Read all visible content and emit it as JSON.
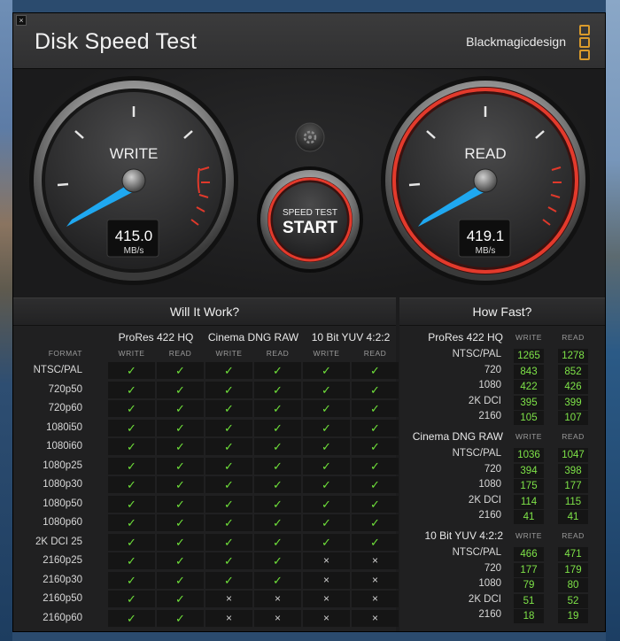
{
  "window": {
    "title": "Disk Speed Test",
    "brand": "Blackmagicdesign",
    "close_icon": "×"
  },
  "gauges": {
    "write": {
      "label": "WRITE",
      "value": "415.0",
      "unit": "MB/s"
    },
    "read": {
      "label": "READ",
      "value": "419.1",
      "unit": "MB/s"
    }
  },
  "start_button": {
    "line1": "SPEED TEST",
    "line2": "START"
  },
  "will_it_work": {
    "title": "Will It Work?",
    "format_header": "FORMAT",
    "groups": [
      "ProRes 422 HQ",
      "Cinema DNG RAW",
      "10 Bit YUV 4:2:2"
    ],
    "sub": [
      "WRITE",
      "READ"
    ],
    "rows": [
      {
        "format": "NTSC/PAL",
        "cells": [
          1,
          1,
          1,
          1,
          1,
          1
        ]
      },
      {
        "format": "720p50",
        "cells": [
          1,
          1,
          1,
          1,
          1,
          1
        ]
      },
      {
        "format": "720p60",
        "cells": [
          1,
          1,
          1,
          1,
          1,
          1
        ]
      },
      {
        "format": "1080i50",
        "cells": [
          1,
          1,
          1,
          1,
          1,
          1
        ]
      },
      {
        "format": "1080i60",
        "cells": [
          1,
          1,
          1,
          1,
          1,
          1
        ]
      },
      {
        "format": "1080p25",
        "cells": [
          1,
          1,
          1,
          1,
          1,
          1
        ]
      },
      {
        "format": "1080p30",
        "cells": [
          1,
          1,
          1,
          1,
          1,
          1
        ]
      },
      {
        "format": "1080p50",
        "cells": [
          1,
          1,
          1,
          1,
          1,
          1
        ]
      },
      {
        "format": "1080p60",
        "cells": [
          1,
          1,
          1,
          1,
          1,
          1
        ]
      },
      {
        "format": "2K DCI 25",
        "cells": [
          1,
          1,
          1,
          1,
          1,
          1
        ]
      },
      {
        "format": "2160p25",
        "cells": [
          1,
          1,
          1,
          1,
          0,
          0
        ]
      },
      {
        "format": "2160p30",
        "cells": [
          1,
          1,
          1,
          1,
          0,
          0
        ]
      },
      {
        "format": "2160p50",
        "cells": [
          1,
          1,
          0,
          0,
          0,
          0
        ]
      },
      {
        "format": "2160p60",
        "cells": [
          1,
          1,
          0,
          0,
          0,
          0
        ]
      }
    ],
    "check_symbol": "✓",
    "cross_symbol": "×"
  },
  "how_fast": {
    "title": "How Fast?",
    "sub": [
      "WRITE",
      "READ"
    ],
    "groups": [
      {
        "name": "ProRes 422 HQ",
        "rows": [
          {
            "label": "NTSC/PAL",
            "write": "1265",
            "read": "1278"
          },
          {
            "label": "720",
            "write": "843",
            "read": "852"
          },
          {
            "label": "1080",
            "write": "422",
            "read": "426"
          },
          {
            "label": "2K DCI",
            "write": "395",
            "read": "399"
          },
          {
            "label": "2160",
            "write": "105",
            "read": "107"
          }
        ]
      },
      {
        "name": "Cinema DNG RAW",
        "rows": [
          {
            "label": "NTSC/PAL",
            "write": "1036",
            "read": "1047"
          },
          {
            "label": "720",
            "write": "394",
            "read": "398"
          },
          {
            "label": "1080",
            "write": "175",
            "read": "177"
          },
          {
            "label": "2K DCI",
            "write": "114",
            "read": "115"
          },
          {
            "label": "2160",
            "write": "41",
            "read": "41"
          }
        ]
      },
      {
        "name": "10 Bit YUV 4:2:2",
        "rows": [
          {
            "label": "NTSC/PAL",
            "write": "466",
            "read": "471"
          },
          {
            "label": "720",
            "write": "177",
            "read": "179"
          },
          {
            "label": "1080",
            "write": "79",
            "read": "80"
          },
          {
            "label": "2K DCI",
            "write": "51",
            "read": "52"
          },
          {
            "label": "2160",
            "write": "18",
            "read": "19"
          }
        ]
      }
    ]
  },
  "colors": {
    "check": "#6fe03a",
    "value": "#7ee348",
    "needle": "#1fa8f0",
    "red_zone": "#e0392b",
    "brand_logo": "#d99a2b"
  }
}
